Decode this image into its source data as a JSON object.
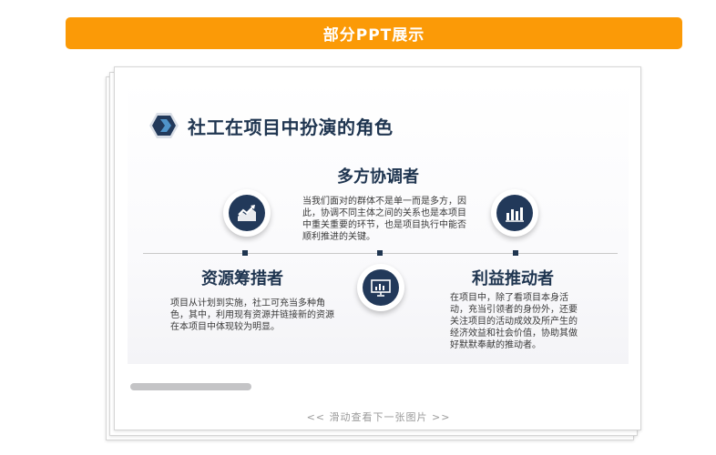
{
  "banner": {
    "label": "部分PPT展示",
    "color": "#fb9a07"
  },
  "slide": {
    "title": "社工在项目中扮演的角色",
    "title_icon": "hexagon-chevron-icon",
    "sections": [
      {
        "heading": "多方协调者",
        "text": "当我们面对的群体不是单一而是多方，因此，协调不同主体之间的关系也是本项目中重关重要的环节，也是项目执行中能否顺利推进的关键。",
        "icon": "trending-chart-icon"
      },
      {
        "heading": "资源筹措者",
        "text": "项目从计划到实施，社工可充当多种角色，其中，利用现有资源并链接新的资源在本项目中体现较为明显。",
        "icon": "presentation-board-icon"
      },
      {
        "heading": "利益推动者",
        "text": "在项目中，除了看项目本身活动，充当引领者的身份外，还要关注项目的活动成效及所产生的经济效益和社会价值，协助其做好默默奉献的推动者。",
        "icon": "bar-chart-icon"
      }
    ],
    "accent_color": "#1f3550"
  },
  "carousel": {
    "hint": "<< 滑动查看下一张图片 >>"
  }
}
